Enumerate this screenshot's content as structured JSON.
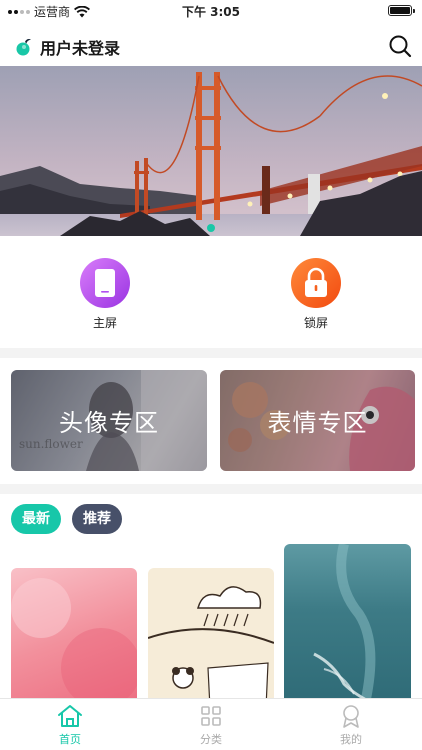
{
  "status_bar": {
    "carrier": "运营商",
    "time": "下午 3:05"
  },
  "header": {
    "title": "用户未登录",
    "logo_icon": "app-logo-icon",
    "search_icon": "search-icon"
  },
  "banner": {
    "image": "golden-gate-bridge-sunset",
    "slide_count": 1,
    "active_slide": 1
  },
  "shortcuts": [
    {
      "label": "主屏",
      "icon": "phone-screen-icon",
      "color": "#b050f0"
    },
    {
      "label": "锁屏",
      "icon": "padlock-icon",
      "color": "#f5601e"
    }
  ],
  "zones": [
    {
      "label": "头像专区"
    },
    {
      "label": "表情专区"
    }
  ],
  "tags": [
    {
      "label": "最新",
      "active": true,
      "color": "#17c7a9"
    },
    {
      "label": "推荐",
      "active": false,
      "color": "#475069"
    }
  ],
  "wallpapers": [
    {
      "image": "pink-texture"
    },
    {
      "image": "cartoon-sketch"
    },
    {
      "image": "ocean-aerial"
    }
  ],
  "tabbar": [
    {
      "label": "首页",
      "icon": "home-icon",
      "active": true
    },
    {
      "label": "分类",
      "icon": "category-grid-icon",
      "active": false
    },
    {
      "label": "我的",
      "icon": "profile-icon",
      "active": false
    }
  ],
  "colors": {
    "accent": "#17c7a9",
    "separator": "#f3f3f3"
  }
}
